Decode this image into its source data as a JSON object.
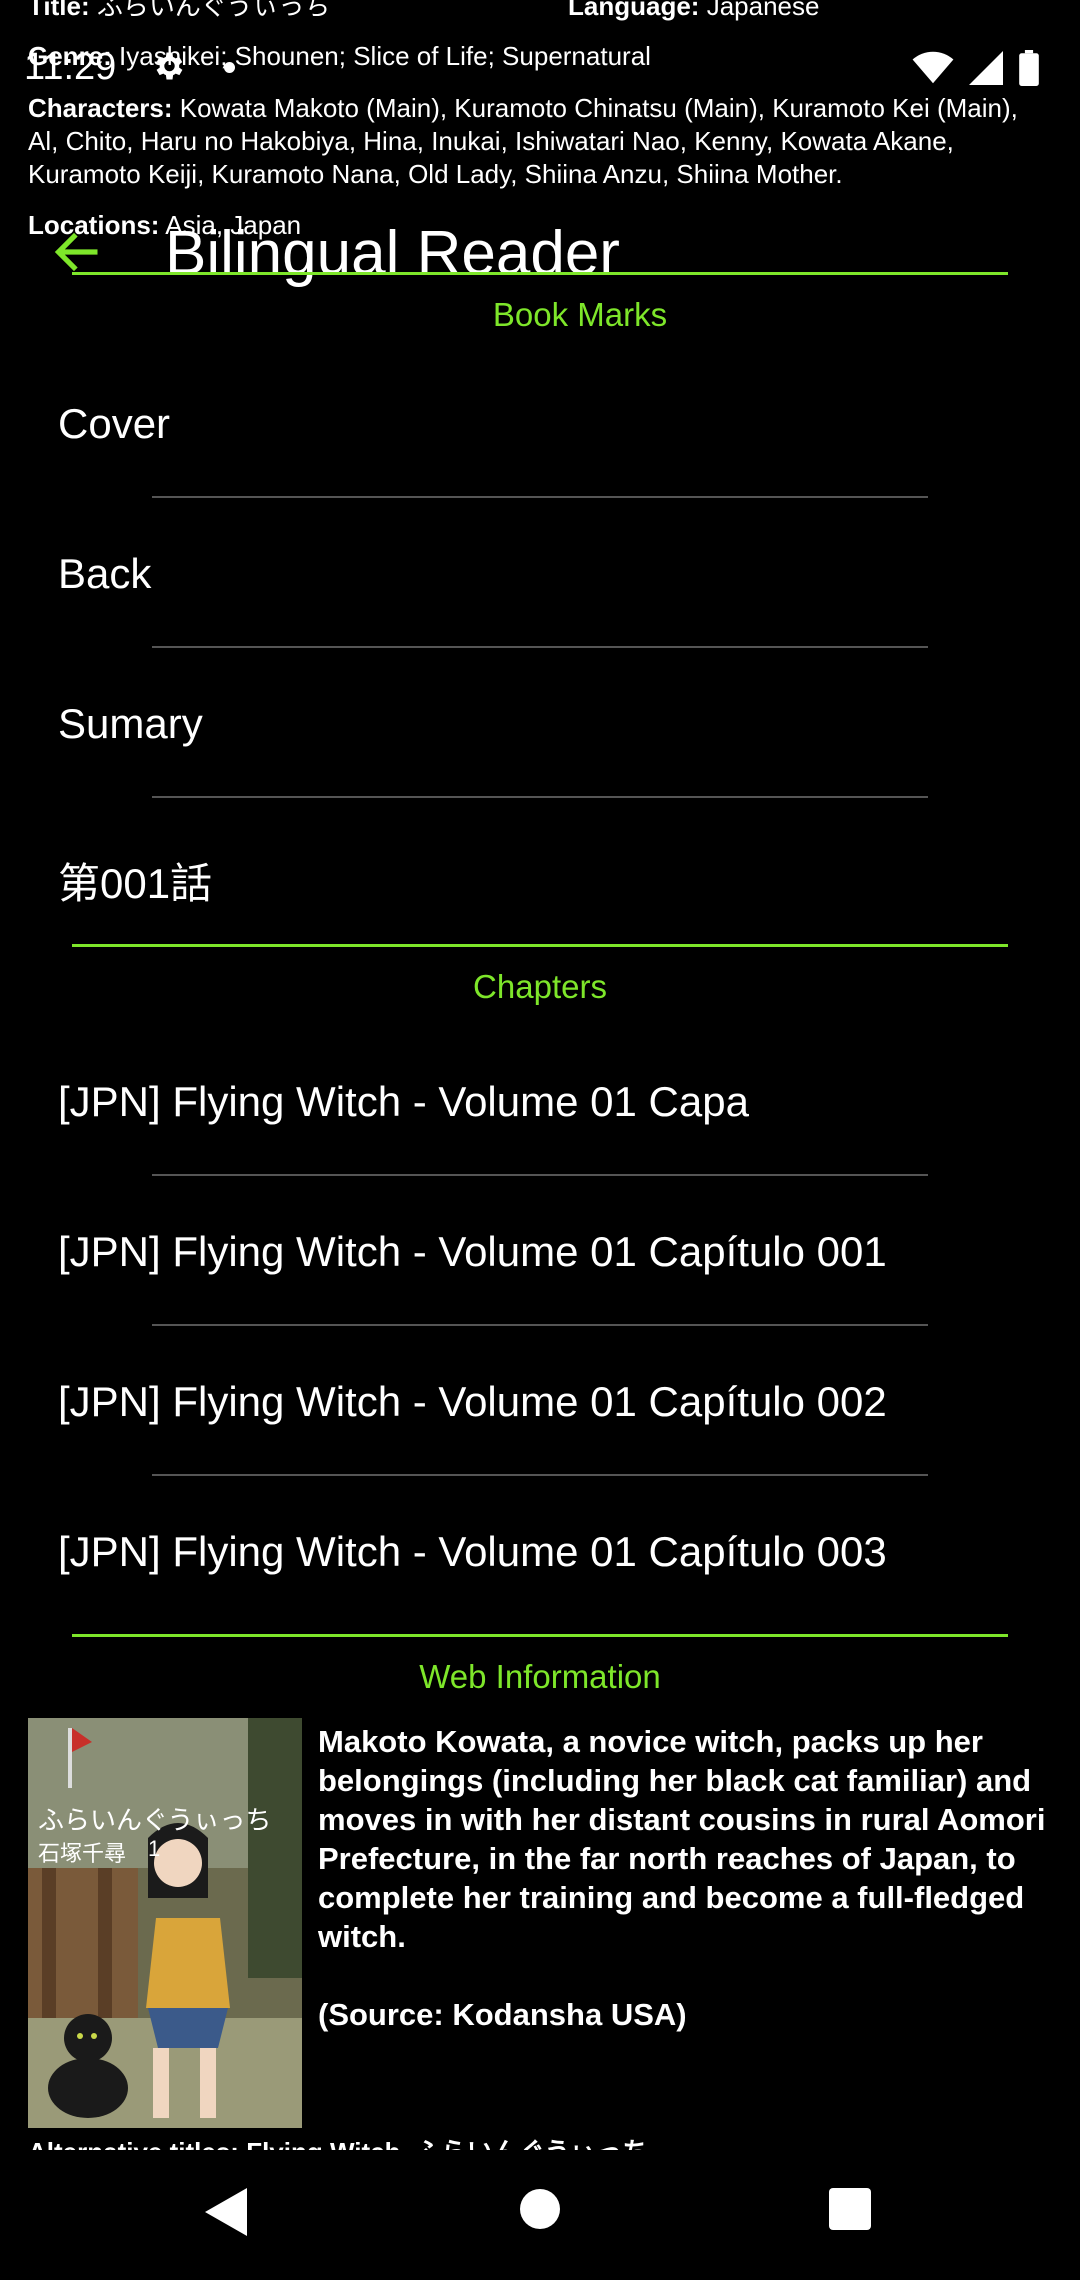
{
  "meta": {
    "title_label": "Title:",
    "title_value": "ふらいんぐうぃっち",
    "language_label": "Language:",
    "language_value": "Japanese",
    "genre_label": "Genre:",
    "genre_value": "Iyashikei; Shounen; Slice of Life; Supernatural",
    "characters_label": "Characters:",
    "characters_value": "Kowata Makoto (Main), Kuramoto Chinatsu (Main), Kuramoto Kei (Main), Al, Chito, Haru no Hakobiya, Hina, Inukai, Ishiwatari Nao, Kenny, Kowata Akane, Kuramoto Keiji, Kuramoto Nana, Old Lady, Shiina Anzu, Shiina Mother.",
    "locations_label": "Locations:",
    "locations_value": "Asia, Japan"
  },
  "status_bar": {
    "time": "11:29",
    "icons": [
      "settings-icon",
      "dot-icon",
      "wifi-icon",
      "signal-icon",
      "battery-icon"
    ]
  },
  "app_bar": {
    "title": "Bilingual Reader",
    "back_icon": "arrow-left-icon"
  },
  "bookmarks": {
    "header": "Book Marks",
    "items": [
      "Cover",
      "Back",
      "Sumary",
      "第001話"
    ]
  },
  "chapters": {
    "header": "Chapters",
    "items": [
      "[JPN] Flying Witch - Volume 01 Capa",
      "[JPN] Flying Witch - Volume 01 Capítulo 001",
      "[JPN] Flying Witch - Volume 01 Capítulo 002",
      "[JPN] Flying Witch - Volume 01 Capítulo 003"
    ]
  },
  "web_info": {
    "header": "Web Information",
    "cover_title_jp": "ふらいんぐうぃっち",
    "cover_author": "石塚千尋",
    "cover_volume": "1",
    "summary": "Makoto Kowata, a novice witch, packs up her belongings (including her black cat familiar) and moves in with her distant cousins in rural Aomori Prefecture, in the far north reaches of Japan, to complete her training and become a full-fledged witch.",
    "source": "(Source: Kodansha USA)",
    "alt_titles_label": "Alternative titles:",
    "alt_titles_value": "Flying Witch, ふらいんぐうぃっち"
  },
  "nav_bar": {
    "icons": [
      "back-triangle-icon",
      "home-circle-icon",
      "recents-square-icon"
    ]
  },
  "colors": {
    "accent": "#7ee62a",
    "background": "#000000",
    "divider": "#555555"
  }
}
